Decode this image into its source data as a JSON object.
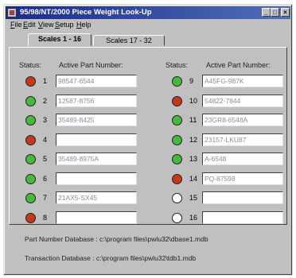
{
  "window": {
    "title": "95/98/NT/2000 Piece Weight Look-Up",
    "controls": {
      "minimize": "_",
      "maximize": "□",
      "close": "×"
    }
  },
  "menu": [
    {
      "mnemonic": "F",
      "rest": "ile"
    },
    {
      "mnemonic": "E",
      "rest": "dit"
    },
    {
      "mnemonic": "V",
      "rest": "iew"
    },
    {
      "mnemonic": "S",
      "rest": "etup"
    },
    {
      "mnemonic": "H",
      "rest": "elp"
    }
  ],
  "tabs": [
    {
      "label": "Scales 1 - 16",
      "active": true
    },
    {
      "label": "Scales 17 - 32",
      "active": false
    }
  ],
  "headers": {
    "status": "Status:",
    "part": "Active Part Number:"
  },
  "colors": {
    "green": "#44b83c",
    "red": "#c4381c",
    "white": "#ffffff"
  },
  "left_scales": [
    {
      "num": "1",
      "status": "red",
      "part": "98547-6544"
    },
    {
      "num": "2",
      "status": "green",
      "part": "12587-8756"
    },
    {
      "num": "3",
      "status": "green",
      "part": "35489-8425"
    },
    {
      "num": "4",
      "status": "red",
      "part": ""
    },
    {
      "num": "5",
      "status": "green",
      "part": "35489-8975A"
    },
    {
      "num": "6",
      "status": "green",
      "part": ""
    },
    {
      "num": "7",
      "status": "green",
      "part": "21AX5-SX45"
    },
    {
      "num": "8",
      "status": "red",
      "part": ""
    }
  ],
  "right_scales": [
    {
      "num": "9",
      "status": "green",
      "part": "A45FG-987K"
    },
    {
      "num": "10",
      "status": "red",
      "part": "54822-7844"
    },
    {
      "num": "11",
      "status": "green",
      "part": "23GR8-6548A"
    },
    {
      "num": "12",
      "status": "green",
      "part": "23157-LKU87"
    },
    {
      "num": "13",
      "status": "green",
      "part": "A-6548"
    },
    {
      "num": "14",
      "status": "red",
      "part": "PQ-87598"
    },
    {
      "num": "15",
      "status": "white",
      "part": ""
    },
    {
      "num": "16",
      "status": "white",
      "part": ""
    }
  ],
  "footer": {
    "part_db": "Part Number Database :  c:\\program files\\pwlu32\\dbase1.mdb",
    "trans_db": "Transaction Database :  c:\\program files\\pwlu32\\tdb1.mdb"
  }
}
